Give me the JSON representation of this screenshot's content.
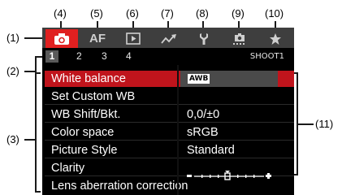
{
  "callouts": {
    "c1": "(1)",
    "c2": "(2)",
    "c3": "(3)",
    "c4": "(4)",
    "c5": "(5)",
    "c6": "(6)",
    "c7": "(7)",
    "c8": "(8)",
    "c9": "(9)",
    "c10": "(10)",
    "c11": "(11)"
  },
  "tabs": [
    {
      "icon": "camera-icon",
      "active": true
    },
    {
      "label": "AF",
      "icon": "af-icon"
    },
    {
      "icon": "playback-icon"
    },
    {
      "icon": "wireless-icon"
    },
    {
      "icon": "wrench-icon"
    },
    {
      "icon": "custom-function-icon"
    },
    {
      "icon": "star-icon"
    }
  ],
  "pages": [
    "1",
    "2",
    "3",
    "4"
  ],
  "active_page": "1",
  "tab_name": "SHOOT1",
  "menu_items": [
    {
      "label": "White balance",
      "value": "AWB",
      "selected": true
    },
    {
      "label": "Set Custom WB",
      "value": ""
    },
    {
      "label": "WB Shift/Bkt.",
      "value": "0,0/±0"
    },
    {
      "label": "Color space",
      "value": "sRGB"
    },
    {
      "label": "Picture Style",
      "value": "Standard"
    },
    {
      "label": "Clarity",
      "value": ""
    },
    {
      "label": "Lens aberration correction",
      "value": ""
    }
  ],
  "clarity_level": 0,
  "colors": {
    "accent": "#e02020",
    "background": "#000000",
    "tabbar": "#3e3e3e"
  }
}
